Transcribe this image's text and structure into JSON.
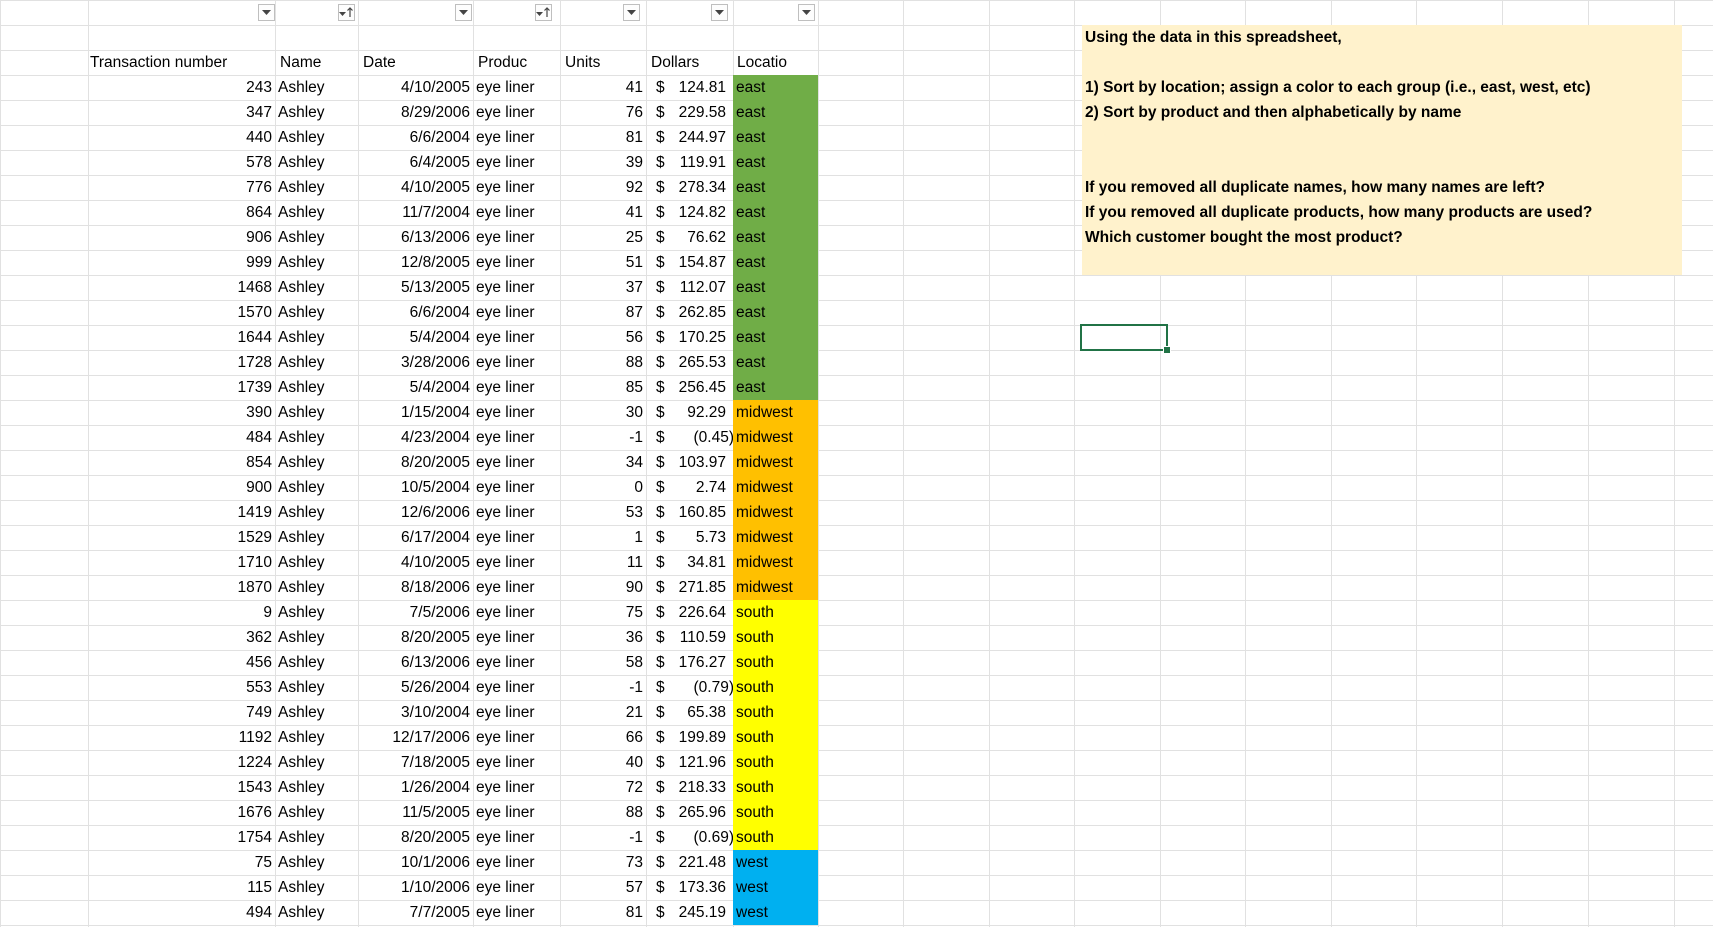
{
  "headers": {
    "transaction": "Transaction number",
    "name": "Name",
    "date": "Date",
    "product": "Produc",
    "units": "Units",
    "dollars": "Dollars",
    "location": "Locatio"
  },
  "location_colors": {
    "east": "#70ad47",
    "midwest": "#ffc000",
    "south": "#ffff00",
    "west": "#00b0f0"
  },
  "rows": [
    {
      "txn": "243",
      "name": "Ashley",
      "date": "4/10/2005",
      "product": "eye liner",
      "units": "41",
      "dollars": "124.81",
      "location": "east"
    },
    {
      "txn": "347",
      "name": "Ashley",
      "date": "8/29/2006",
      "product": "eye liner",
      "units": "76",
      "dollars": "229.58",
      "location": "east"
    },
    {
      "txn": "440",
      "name": "Ashley",
      "date": "6/6/2004",
      "product": "eye liner",
      "units": "81",
      "dollars": "244.97",
      "location": "east"
    },
    {
      "txn": "578",
      "name": "Ashley",
      "date": "6/4/2005",
      "product": "eye liner",
      "units": "39",
      "dollars": "119.91",
      "location": "east"
    },
    {
      "txn": "776",
      "name": "Ashley",
      "date": "4/10/2005",
      "product": "eye liner",
      "units": "92",
      "dollars": "278.34",
      "location": "east"
    },
    {
      "txn": "864",
      "name": "Ashley",
      "date": "11/7/2004",
      "product": "eye liner",
      "units": "41",
      "dollars": "124.82",
      "location": "east"
    },
    {
      "txn": "906",
      "name": "Ashley",
      "date": "6/13/2006",
      "product": "eye liner",
      "units": "25",
      "dollars": "76.62",
      "location": "east"
    },
    {
      "txn": "999",
      "name": "Ashley",
      "date": "12/8/2005",
      "product": "eye liner",
      "units": "51",
      "dollars": "154.87",
      "location": "east"
    },
    {
      "txn": "1468",
      "name": "Ashley",
      "date": "5/13/2005",
      "product": "eye liner",
      "units": "37",
      "dollars": "112.07",
      "location": "east"
    },
    {
      "txn": "1570",
      "name": "Ashley",
      "date": "6/6/2004",
      "product": "eye liner",
      "units": "87",
      "dollars": "262.85",
      "location": "east"
    },
    {
      "txn": "1644",
      "name": "Ashley",
      "date": "5/4/2004",
      "product": "eye liner",
      "units": "56",
      "dollars": "170.25",
      "location": "east"
    },
    {
      "txn": "1728",
      "name": "Ashley",
      "date": "3/28/2006",
      "product": "eye liner",
      "units": "88",
      "dollars": "265.53",
      "location": "east"
    },
    {
      "txn": "1739",
      "name": "Ashley",
      "date": "5/4/2004",
      "product": "eye liner",
      "units": "85",
      "dollars": "256.45",
      "location": "east"
    },
    {
      "txn": "390",
      "name": "Ashley",
      "date": "1/15/2004",
      "product": "eye liner",
      "units": "30",
      "dollars": "92.29",
      "location": "midwest"
    },
    {
      "txn": "484",
      "name": "Ashley",
      "date": "4/23/2004",
      "product": "eye liner",
      "units": "-1",
      "dollars": "(0.45)",
      "location": "midwest"
    },
    {
      "txn": "854",
      "name": "Ashley",
      "date": "8/20/2005",
      "product": "eye liner",
      "units": "34",
      "dollars": "103.97",
      "location": "midwest"
    },
    {
      "txn": "900",
      "name": "Ashley",
      "date": "10/5/2004",
      "product": "eye liner",
      "units": "0",
      "dollars": "2.74",
      "location": "midwest"
    },
    {
      "txn": "1419",
      "name": "Ashley",
      "date": "12/6/2006",
      "product": "eye liner",
      "units": "53",
      "dollars": "160.85",
      "location": "midwest"
    },
    {
      "txn": "1529",
      "name": "Ashley",
      "date": "6/17/2004",
      "product": "eye liner",
      "units": "1",
      "dollars": "5.73",
      "location": "midwest"
    },
    {
      "txn": "1710",
      "name": "Ashley",
      "date": "4/10/2005",
      "product": "eye liner",
      "units": "11",
      "dollars": "34.81",
      "location": "midwest"
    },
    {
      "txn": "1870",
      "name": "Ashley",
      "date": "8/18/2006",
      "product": "eye liner",
      "units": "90",
      "dollars": "271.85",
      "location": "midwest"
    },
    {
      "txn": "9",
      "name": "Ashley",
      "date": "7/5/2006",
      "product": "eye liner",
      "units": "75",
      "dollars": "226.64",
      "location": "south"
    },
    {
      "txn": "362",
      "name": "Ashley",
      "date": "8/20/2005",
      "product": "eye liner",
      "units": "36",
      "dollars": "110.59",
      "location": "south"
    },
    {
      "txn": "456",
      "name": "Ashley",
      "date": "6/13/2006",
      "product": "eye liner",
      "units": "58",
      "dollars": "176.27",
      "location": "south"
    },
    {
      "txn": "553",
      "name": "Ashley",
      "date": "5/26/2004",
      "product": "eye liner",
      "units": "-1",
      "dollars": "(0.79)",
      "location": "south"
    },
    {
      "txn": "749",
      "name": "Ashley",
      "date": "3/10/2004",
      "product": "eye liner",
      "units": "21",
      "dollars": "65.38",
      "location": "south"
    },
    {
      "txn": "1192",
      "name": "Ashley",
      "date": "12/17/2006",
      "product": "eye liner",
      "units": "66",
      "dollars": "199.89",
      "location": "south"
    },
    {
      "txn": "1224",
      "name": "Ashley",
      "date": "7/18/2005",
      "product": "eye liner",
      "units": "40",
      "dollars": "121.96",
      "location": "south"
    },
    {
      "txn": "1543",
      "name": "Ashley",
      "date": "1/26/2004",
      "product": "eye liner",
      "units": "72",
      "dollars": "218.33",
      "location": "south"
    },
    {
      "txn": "1676",
      "name": "Ashley",
      "date": "11/5/2005",
      "product": "eye liner",
      "units": "88",
      "dollars": "265.96",
      "location": "south"
    },
    {
      "txn": "1754",
      "name": "Ashley",
      "date": "8/20/2005",
      "product": "eye liner",
      "units": "-1",
      "dollars": "(0.69)",
      "location": "south"
    },
    {
      "txn": "75",
      "name": "Ashley",
      "date": "10/1/2006",
      "product": "eye liner",
      "units": "73",
      "dollars": "221.48",
      "location": "west"
    },
    {
      "txn": "115",
      "name": "Ashley",
      "date": "1/10/2006",
      "product": "eye liner",
      "units": "57",
      "dollars": "173.36",
      "location": "west"
    },
    {
      "txn": "494",
      "name": "Ashley",
      "date": "7/7/2005",
      "product": "eye liner",
      "units": "81",
      "dollars": "245.19",
      "location": "west"
    }
  ],
  "instructions": [
    "Using the data in this spreadsheet,",
    "1) Sort by location; assign a color to each group (i.e., east, west, etc)",
    "2) Sort by product and then alphabetically by name",
    "If you removed all duplicate names, how many names are left?",
    "If you removed all duplicate products, how many products are used?",
    "Which customer bought the most product?"
  ],
  "currency_symbol": "$",
  "grid_color": "#e1e1e1",
  "selection_color": "#217346"
}
